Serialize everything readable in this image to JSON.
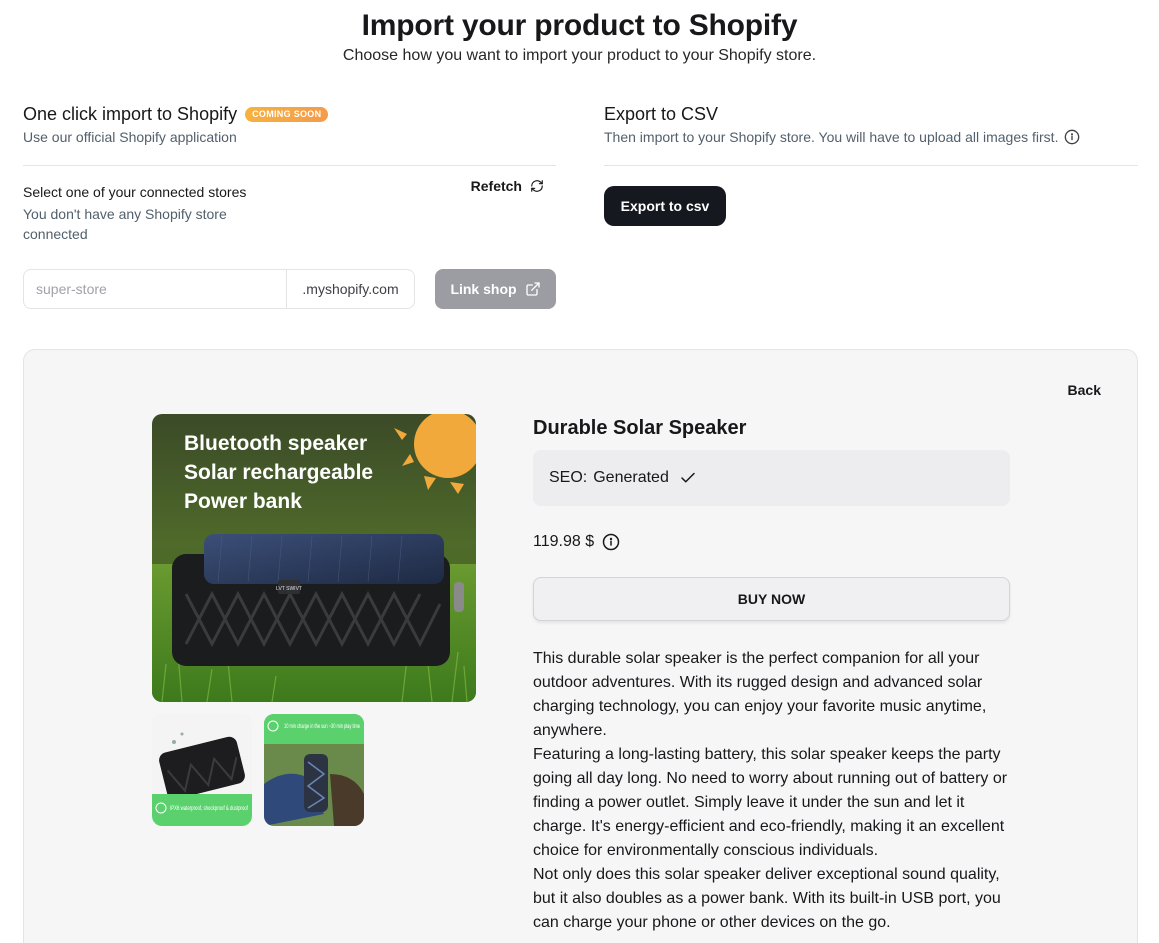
{
  "header": {
    "title": "Import your product to Shopify",
    "subtitle": "Choose how you want to import your product to your Shopify store."
  },
  "one_click": {
    "title": "One click import to Shopify",
    "badge": "COMING SOON",
    "subtitle": "Use our official Shopify application",
    "stores_label": "Select one of your connected stores",
    "stores_empty": "You don't have any Shopify store connected",
    "refetch_label": "Refetch",
    "shop_input": {
      "value": "",
      "placeholder": "super-store"
    },
    "shop_suffix": ".myshopify.com",
    "link_button": "Link shop"
  },
  "csv": {
    "title": "Export to CSV",
    "subtitle": "Then import to your Shopify store. You will have to upload all images first.",
    "export_button": "Export to csv"
  },
  "preview": {
    "back_label": "Back",
    "main_image_text": [
      "Bluetooth speaker",
      "Solar rechargeable",
      "Power bank"
    ],
    "speaker_brand": "LVT SWIVT",
    "thumb1_caption": "IPX6 waterproof, shockproof & dustproof",
    "thumb2_caption": "10 min charge in the sun ~30 min play time",
    "product": {
      "title": "Durable Solar Speaker",
      "seo_label": "SEO:",
      "seo_value": "Generated",
      "price": "119.98 $",
      "buy_button": "BUY NOW",
      "description": [
        "This durable solar speaker is the perfect companion for all your outdoor adventures. With its rugged design and advanced solar charging technology, you can enjoy your favorite music anytime, anywhere.",
        "Featuring a long-lasting battery, this solar speaker keeps the party going all day long. No need to worry about running out of battery or finding a power outlet. Simply leave it under the sun and let it charge. It's energy-efficient and eco-friendly, making it an excellent choice for environmentally conscious individuals.",
        "Not only does this solar speaker deliver exceptional sound quality, but it also doubles as a power bank. With its built-in USB port, you can charge your phone or other devices on the go."
      ]
    }
  },
  "colors": {
    "primary_button": "#16181f",
    "disabled_button": "#9b9da3",
    "badge_gradient_start": "#f6b23e",
    "badge_gradient_end": "#f59a4a",
    "panel_bg": "#f6f6f7",
    "muted_text": "#52606d"
  }
}
